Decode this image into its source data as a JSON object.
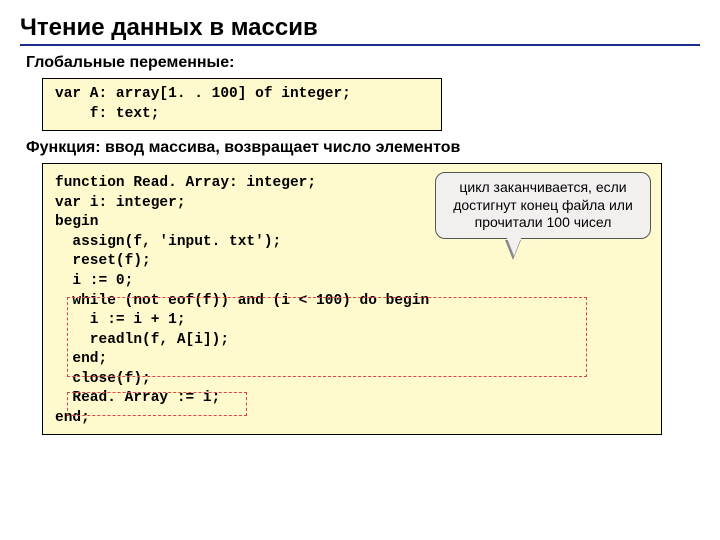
{
  "title": "Чтение данных в массив",
  "sub1": "Глобальные переменные:",
  "code1_l1": "var A: array[1. . 100] of integer;",
  "code1_l2": "    f: text;",
  "sub2": "Функция: ввод массива, возвращает число элементов",
  "callout": "цикл заканчивается, если достигнут конец файла или прочитали 100 чисел",
  "c2": {
    "l1a": "function Read. Array: integer;",
    "l2": "var i: integer;",
    "l3": "begin",
    "l4": "  assign(f, 'input. txt');",
    "l5": "  reset(f);",
    "l6": "  i := 0;",
    "l7a": "  while (not eof(f)) and (i < 100) do begin",
    "l8": "    i := i + 1;",
    "l9": "    readln(f, A[i]);",
    "l10": "  end;",
    "l11": "  close(f);",
    "l12": "  Read. Array := i;",
    "l13": "end;"
  }
}
